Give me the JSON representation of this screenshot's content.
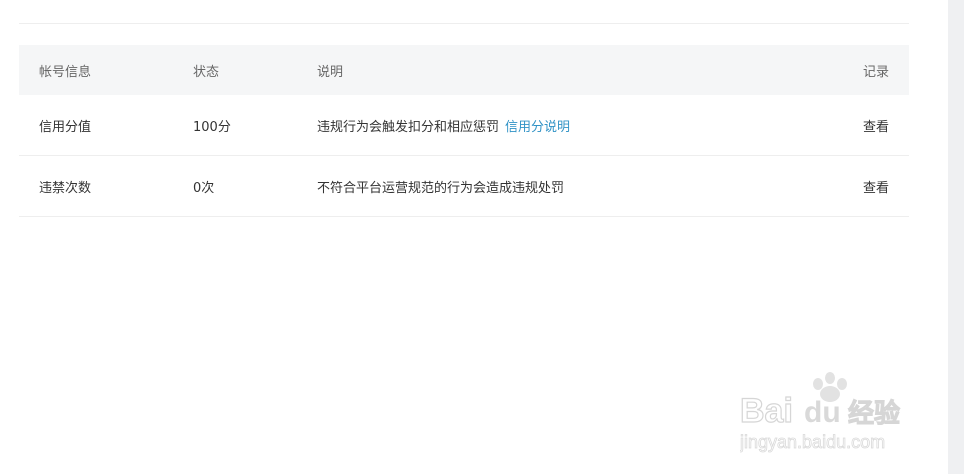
{
  "table": {
    "headers": {
      "account": "帐号信息",
      "status": "状态",
      "description": "说明",
      "record": "记录"
    },
    "rows": [
      {
        "account": "信用分值",
        "status": "100分",
        "description": "违规行为会触发扣分和相应惩罚",
        "description_link": "信用分说明",
        "record": "查看"
      },
      {
        "account": "违禁次数",
        "status": "0次",
        "description": "不符合平台运营规范的行为会造成违规处罚",
        "record": "查看"
      }
    ]
  },
  "watermark": {
    "brand": "Bai",
    "brand_du": "du",
    "brand_cn": "经验",
    "url": "jingyan.baidu.com"
  },
  "colors": {
    "link": "#3193c6",
    "header_bg": "#f5f6f7",
    "scroll_track": "#eff0f2"
  }
}
